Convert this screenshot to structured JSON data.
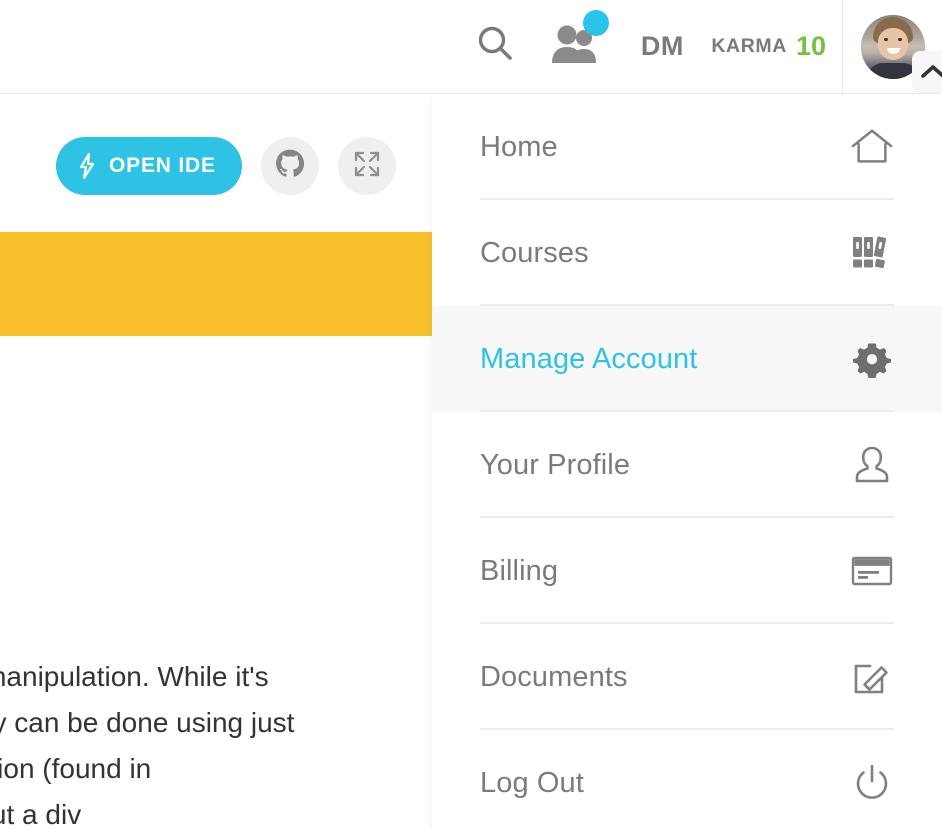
{
  "header": {
    "search_icon": "search-icon",
    "friends_icon": "friends-icon",
    "friends_badge": "",
    "dm_label": "DM",
    "karma_label": "KARMA",
    "karma_value": "10",
    "avatar_alt": "user-avatar",
    "chevron": "chevron-up-icon"
  },
  "toolbar": {
    "open_ide_label": "OPEN IDE",
    "bolt_icon": "bolt-icon",
    "github_icon": "github-icon",
    "fullscreen_icon": "fullscreen-icon"
  },
  "banner": {
    "color": "#f7c02b"
  },
  "article": {
    "line1": "M manipulation. While it's",
    "line2": "uery can be done using just",
    "line3": "olution (found in",
    "line4": "e out a div"
  },
  "dropdown": {
    "items": [
      {
        "label": "Home",
        "icon": "home-icon",
        "active": false
      },
      {
        "label": "Courses",
        "icon": "books-icon",
        "active": false
      },
      {
        "label": "Manage Account",
        "icon": "gear-icon",
        "active": true
      },
      {
        "label": "Your Profile",
        "icon": "person-icon",
        "active": false
      },
      {
        "label": "Billing",
        "icon": "credit-card-icon",
        "active": false
      },
      {
        "label": "Documents",
        "icon": "edit-square-icon",
        "active": false
      },
      {
        "label": "Log Out",
        "icon": "power-icon",
        "active": false
      }
    ]
  },
  "colors": {
    "accent": "#2ec2e4",
    "karma_green": "#76c043",
    "banner_yellow": "#f7c02b",
    "text_gray": "#7b7b7b",
    "highlight_bg": "#f7f7f7"
  }
}
